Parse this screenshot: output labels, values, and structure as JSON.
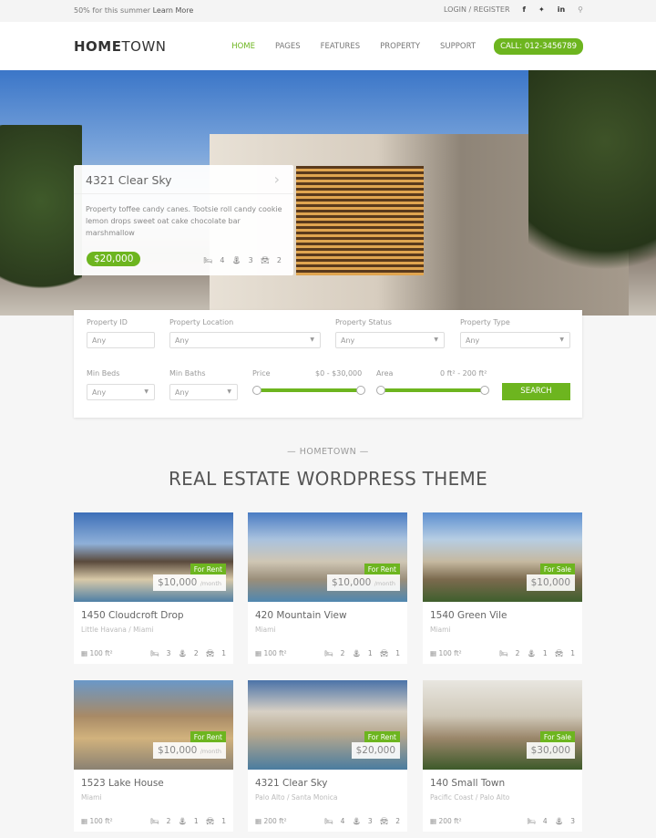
{
  "topbar": {
    "promo": "50% for this summer",
    "learn_more": "Learn More",
    "login": "LOGIN / REGISTER",
    "social": [
      "f",
      "🐦",
      "in"
    ],
    "search_icon": "search-icon"
  },
  "header": {
    "logo_bold": "HOME",
    "logo_light": "TOWN",
    "nav": [
      "HOME",
      "PAGES",
      "FEATURES",
      "PROPERTY",
      "SUPPORT"
    ],
    "active": "HOME",
    "call": "CALL: 012-3456789"
  },
  "hero": {
    "title": "4321 Clear Sky",
    "description": "Property toffee candy canes. Tootsie roll candy cookie lemon drops sweet oat cake chocolate bar marshmallow",
    "price": "$20,000",
    "beds": "4",
    "baths": "3",
    "garage": "2"
  },
  "search": {
    "property_id_label": "Property ID",
    "location_label": "Property Location",
    "status_label": "Property Status",
    "type_label": "Property Type",
    "min_beds_label": "Min Beds",
    "min_baths_label": "Min Baths",
    "price_label": "Price",
    "price_range": "$0 - $30,000",
    "area_label": "Area",
    "area_range": "0 ft² - 200 ft²",
    "any": "Any",
    "button": "SEARCH"
  },
  "section": {
    "kicker": "— HOMETOWN —",
    "title": "REAL ESTATE WORDPRESS THEME"
  },
  "accent": "#6db51f",
  "listings": [
    {
      "name": "1450 Cloudcroft Drop",
      "location": "Little Havana / Miami",
      "status": "For Rent",
      "price": "$10,000",
      "period": "/month",
      "area": "100 ft²",
      "beds": "3",
      "baths": "2",
      "garage": "1"
    },
    {
      "name": "420 Mountain View",
      "location": "Miami",
      "status": "For Rent",
      "price": "$10,000",
      "period": "/month",
      "area": "100 ft²",
      "beds": "2",
      "baths": "1",
      "garage": "1"
    },
    {
      "name": "1540 Green Vile",
      "location": "Miami",
      "status": "For Sale",
      "price": "$10,000",
      "period": "",
      "area": "100 ft²",
      "beds": "2",
      "baths": "1",
      "garage": "1"
    },
    {
      "name": "1523 Lake House",
      "location": "Miami",
      "status": "For Rent",
      "price": "$10,000",
      "period": "/month",
      "area": "100 ft²",
      "beds": "2",
      "baths": "1",
      "garage": "1"
    },
    {
      "name": "4321 Clear Sky",
      "location": "Palo Alto / Santa Monica",
      "status": "For Rent",
      "price": "$20,000",
      "period": "",
      "area": "200 ft²",
      "beds": "4",
      "baths": "3",
      "garage": "2"
    },
    {
      "name": "140 Small Town",
      "location": "Pacific Coast / Palo Alto",
      "status": "For Sale",
      "price": "$30,000",
      "period": "",
      "area": "200 ft²",
      "beds": "4",
      "baths": "3",
      "garage": ""
    }
  ]
}
